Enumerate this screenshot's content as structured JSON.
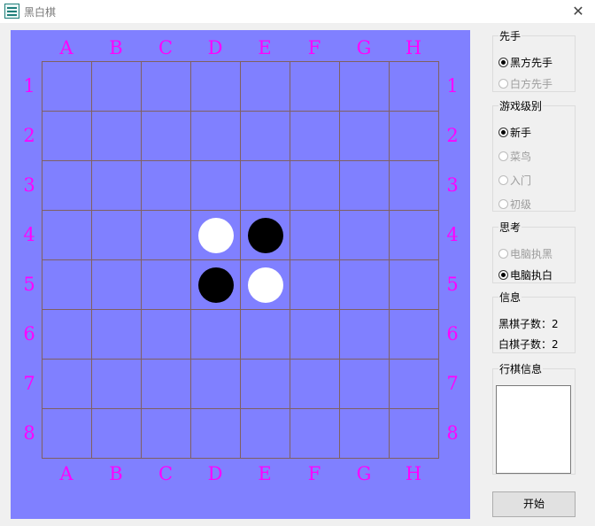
{
  "window": {
    "title": "黑白棋",
    "close_glyph": "✕"
  },
  "board": {
    "columns": [
      "A",
      "B",
      "C",
      "D",
      "E",
      "F",
      "G",
      "H"
    ],
    "rows": [
      "1",
      "2",
      "3",
      "4",
      "5",
      "6",
      "7",
      "8"
    ],
    "pieces": [
      {
        "cell": "D4",
        "color": "white"
      },
      {
        "cell": "E4",
        "color": "black"
      },
      {
        "cell": "D5",
        "color": "black"
      },
      {
        "cell": "E5",
        "color": "white"
      }
    ],
    "colors": {
      "background": "#8080ff",
      "coordinates": "#ff00ff",
      "grid": "#806060"
    }
  },
  "first_move": {
    "legend": "先手",
    "options": [
      {
        "label": "黑方先手",
        "checked": true,
        "enabled": true
      },
      {
        "label": "白方先手",
        "checked": false,
        "enabled": false
      }
    ]
  },
  "level": {
    "legend": "游戏级别",
    "options": [
      {
        "label": "新手",
        "checked": true,
        "enabled": true
      },
      {
        "label": "菜鸟",
        "checked": false,
        "enabled": false
      },
      {
        "label": "入门",
        "checked": false,
        "enabled": false
      },
      {
        "label": "初级",
        "checked": false,
        "enabled": false
      }
    ]
  },
  "think": {
    "legend": "思考",
    "options": [
      {
        "label": "电脑执黑",
        "checked": false,
        "enabled": false
      },
      {
        "label": "电脑执白",
        "checked": true,
        "enabled": true
      }
    ]
  },
  "info": {
    "legend": "信息",
    "black_count": "黑棋子数：2",
    "white_count": "白棋子数：2"
  },
  "move_info": {
    "legend": "行棋信息"
  },
  "start_button": "开始"
}
